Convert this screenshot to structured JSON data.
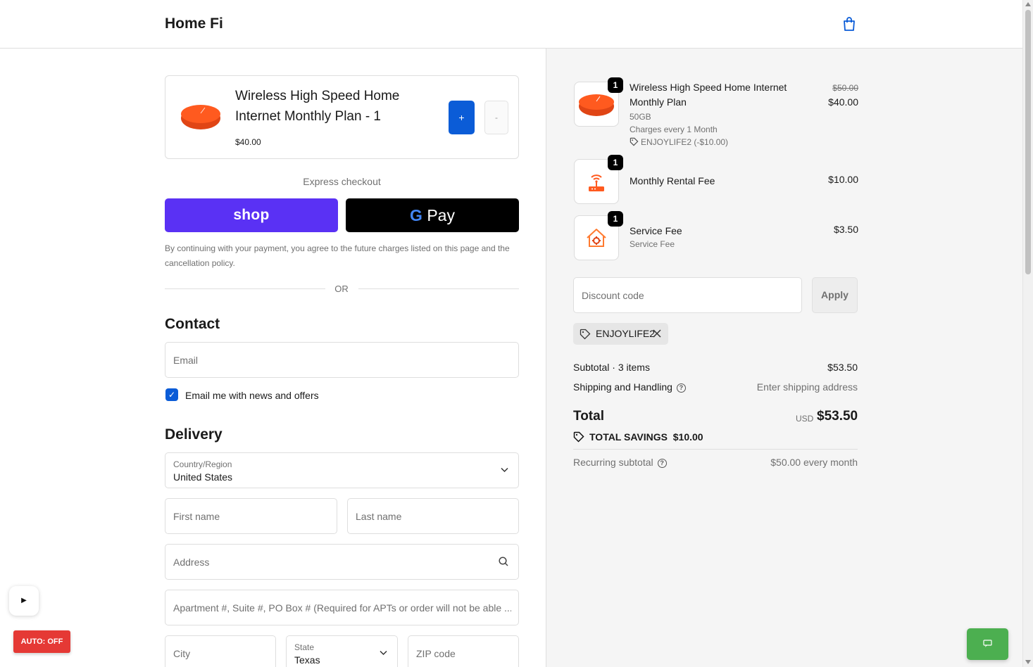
{
  "header": {
    "brand": "Home Fi",
    "cart_icon": "shopping-bag-icon"
  },
  "product_card": {
    "title": "Wireless High Speed Home Internet Monthly Plan - 1",
    "price": "$40.00",
    "plus_label": "+",
    "minus_label": "-"
  },
  "express": {
    "heading": "Express checkout",
    "shop_label": "shop",
    "gpay_g": "G",
    "gpay_label": "Pay",
    "terms": "By continuing with your payment, you agree to the future charges listed on this page and the cancellation policy.",
    "or_label": "OR"
  },
  "contact": {
    "heading": "Contact",
    "email_placeholder": "Email",
    "newsletter_label": "Email me with news and offers",
    "newsletter_checked": true
  },
  "delivery": {
    "heading": "Delivery",
    "country_label": "Country/Region",
    "country_value": "United States",
    "first_name_placeholder": "First name",
    "last_name_placeholder": "Last name",
    "address_placeholder": "Address",
    "apartment_placeholder": "Apartment #, Suite #, PO Box # (Required for APTs or order will not be able ...",
    "city_placeholder": "City",
    "state_label": "State",
    "state_value": "Texas",
    "zip_placeholder": "ZIP code"
  },
  "order_summary": {
    "items": [
      {
        "qty": "1",
        "title": "Wireless High Speed Home Internet Monthly Plan",
        "variant": "50GB",
        "billing": "Charges every 1 Month",
        "discount": "ENJOYLIFE2 (-$10.00)",
        "original_price": "$50.00",
        "price": "$40.00"
      },
      {
        "qty": "1",
        "title": "Monthly Rental Fee",
        "price": "$10.00"
      },
      {
        "qty": "1",
        "title": "Service Fee",
        "subtitle": "Service Fee",
        "price": "$3.50"
      }
    ],
    "discount_placeholder": "Discount code",
    "apply_label": "Apply",
    "applied_code": "ENJOYLIFE2",
    "subtotal_label": "Subtotal · 3 items",
    "subtotal_value": "$53.50",
    "shipping_label": "Shipping and Handling",
    "shipping_value": "Enter shipping address",
    "total_label": "Total",
    "currency": "USD",
    "total_value": "$53.50",
    "savings_label": "TOTAL SAVINGS",
    "savings_value": "$10.00",
    "recurring_label": "Recurring subtotal",
    "recurring_value": "$50.00 every month"
  },
  "widgets": {
    "play_label": "▶",
    "auto_label": "AUTO: OFF"
  },
  "colors": {
    "primary": "#0b5cd7",
    "shop": "#5a31f4",
    "auto": "#e53935",
    "chat": "#4caf50"
  }
}
